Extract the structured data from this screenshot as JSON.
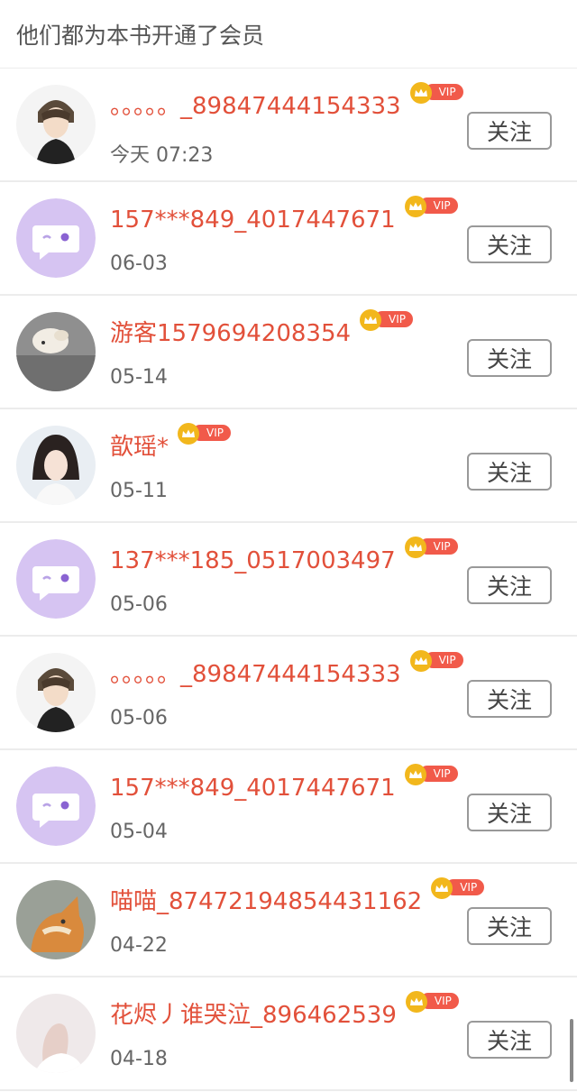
{
  "header": {
    "title": "他们都为本书开通了会员"
  },
  "vip_label": "VIP",
  "follow_label": "关注",
  "colors": {
    "name": "#e2503a",
    "vip_tag": "#f15a4a",
    "crown": "#f2b71c",
    "default_avatar": "#d6c4f2"
  },
  "members": [
    {
      "name": "。。。。。_89847444154333",
      "time": "今天 07:23",
      "avatar": "anime-boy"
    },
    {
      "name": "157***849_4017447671",
      "time": "06-03",
      "avatar": "default"
    },
    {
      "name": "游客1579694208354",
      "time": "05-14",
      "avatar": "dog"
    },
    {
      "name": "歆瑶*",
      "time": "05-11",
      "avatar": "girl"
    },
    {
      "name": "137***185_0517003497",
      "time": "05-06",
      "avatar": "default"
    },
    {
      "name": "。。。。。_89847444154333",
      "time": "05-06",
      "avatar": "anime-boy"
    },
    {
      "name": "157***849_4017447671",
      "time": "05-04",
      "avatar": "default"
    },
    {
      "name": "喵喵_87472194854431162",
      "time": "04-22",
      "avatar": "cat"
    },
    {
      "name": "花烬丿谁哭泣_896462539",
      "time": "04-18",
      "avatar": "hand"
    }
  ]
}
